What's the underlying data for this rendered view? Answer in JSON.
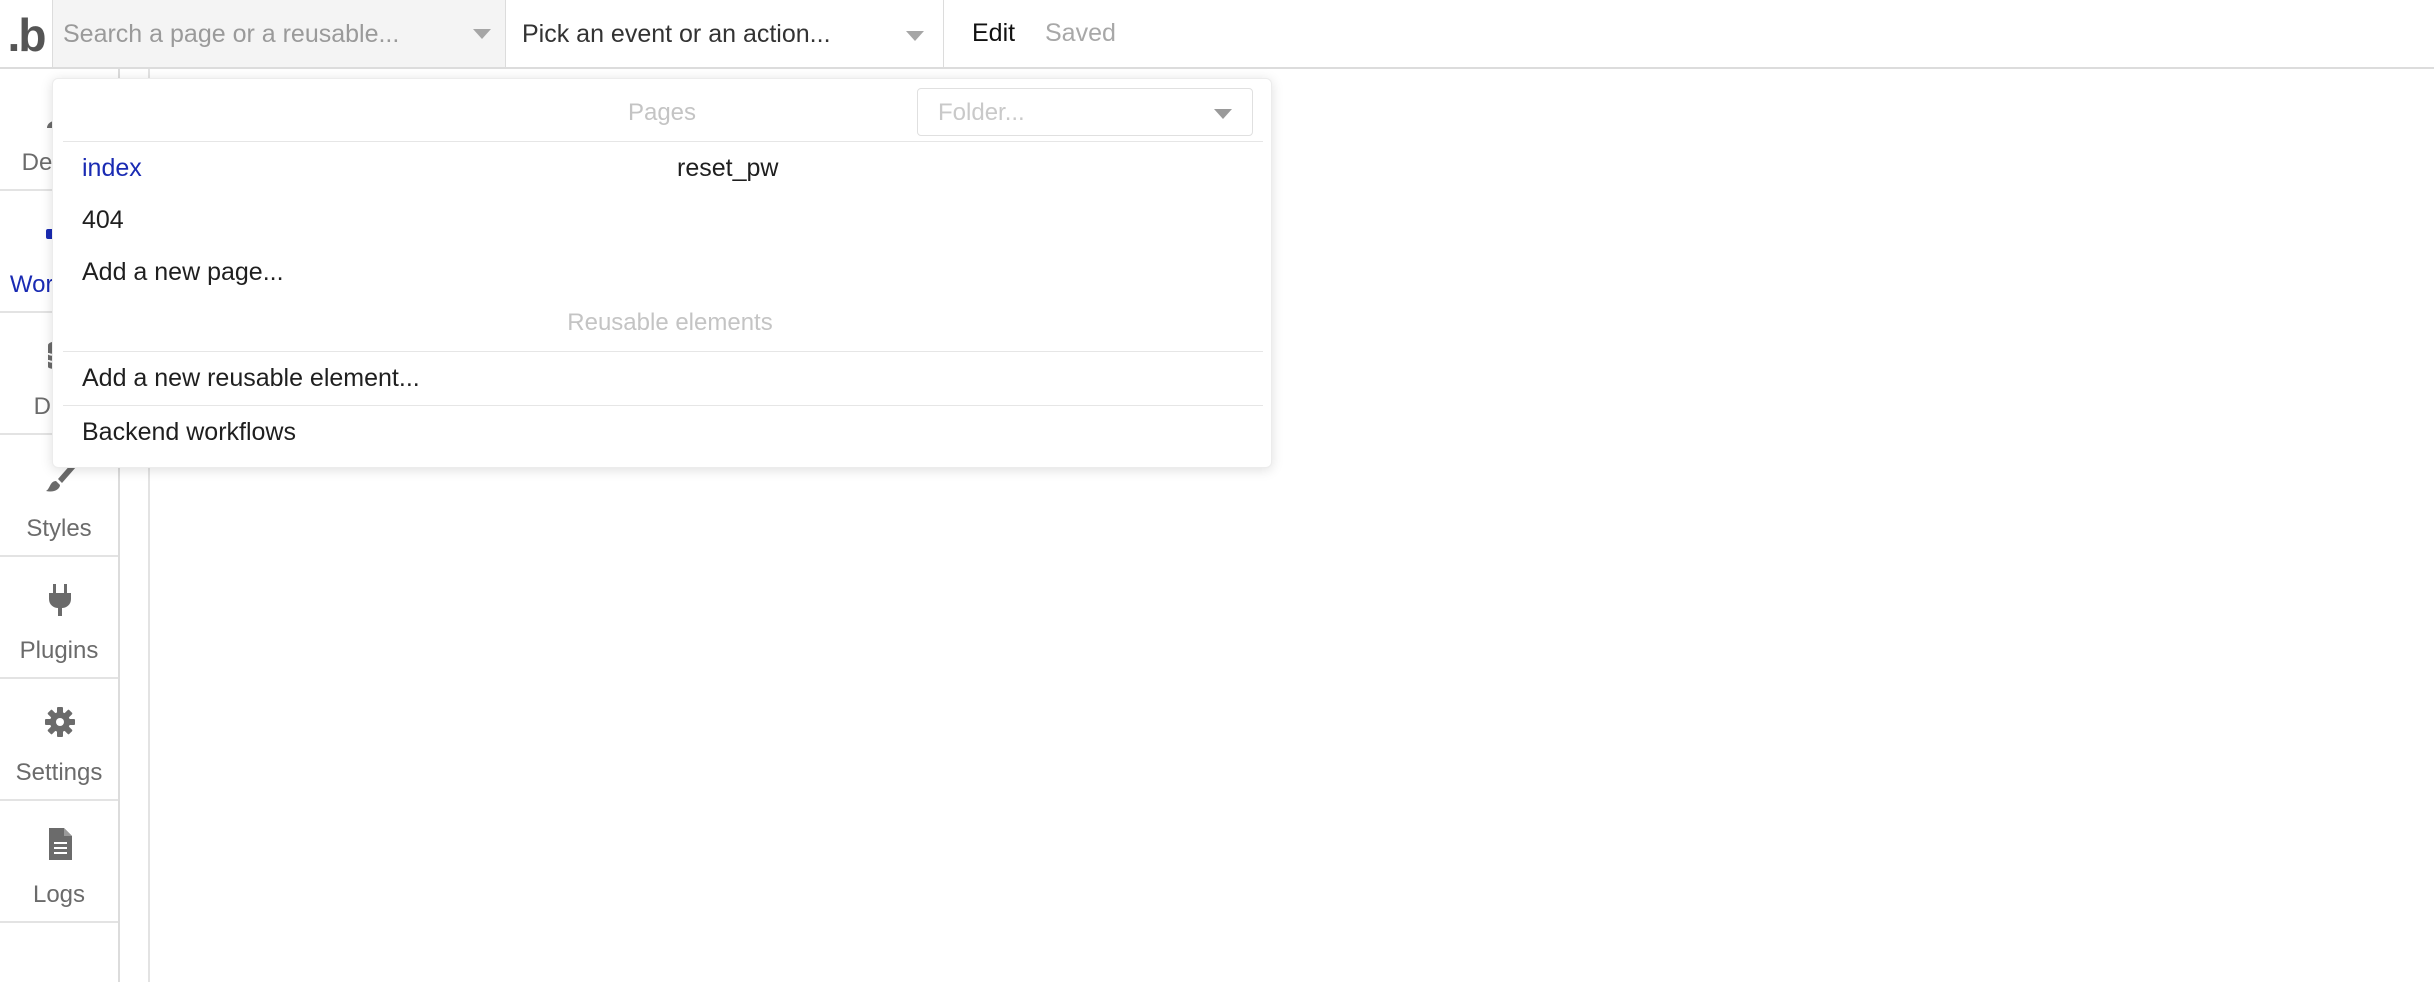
{
  "topbar": {
    "logo": ".b",
    "page_search": {
      "placeholder": "Search a page or a reusable...",
      "value": ""
    },
    "event_picker": {
      "label": "Pick an event or an action..."
    },
    "edit_label": "Edit",
    "saved_label": "Saved"
  },
  "sidebar": {
    "items": [
      {
        "label": "Design",
        "icon": "design-icon",
        "active": false
      },
      {
        "label": "Workflow",
        "icon": "workflow-icon",
        "active": true
      },
      {
        "label": "Data",
        "icon": "data-icon",
        "active": false
      },
      {
        "label": "Styles",
        "icon": "brush-icon",
        "active": false
      },
      {
        "label": "Plugins",
        "icon": "plug-icon",
        "active": false
      },
      {
        "label": "Settings",
        "icon": "gear-icon",
        "active": false
      },
      {
        "label": "Logs",
        "icon": "document-icon",
        "active": false
      }
    ]
  },
  "dropdown": {
    "pages_title": "Pages",
    "folder_placeholder": "Folder...",
    "pages": [
      {
        "name": "index",
        "current": true
      },
      {
        "name": "reset_pw",
        "current": false
      },
      {
        "name": "404",
        "current": false
      }
    ],
    "add_page": "Add a new page...",
    "reusable_title": "Reusable elements",
    "add_reusable": "Add a new reusable element...",
    "backend": "Backend workflows"
  },
  "colors": {
    "accent": "#1a2bb3",
    "muted_text": "#a8a8a8",
    "border": "#dcdcdc"
  }
}
